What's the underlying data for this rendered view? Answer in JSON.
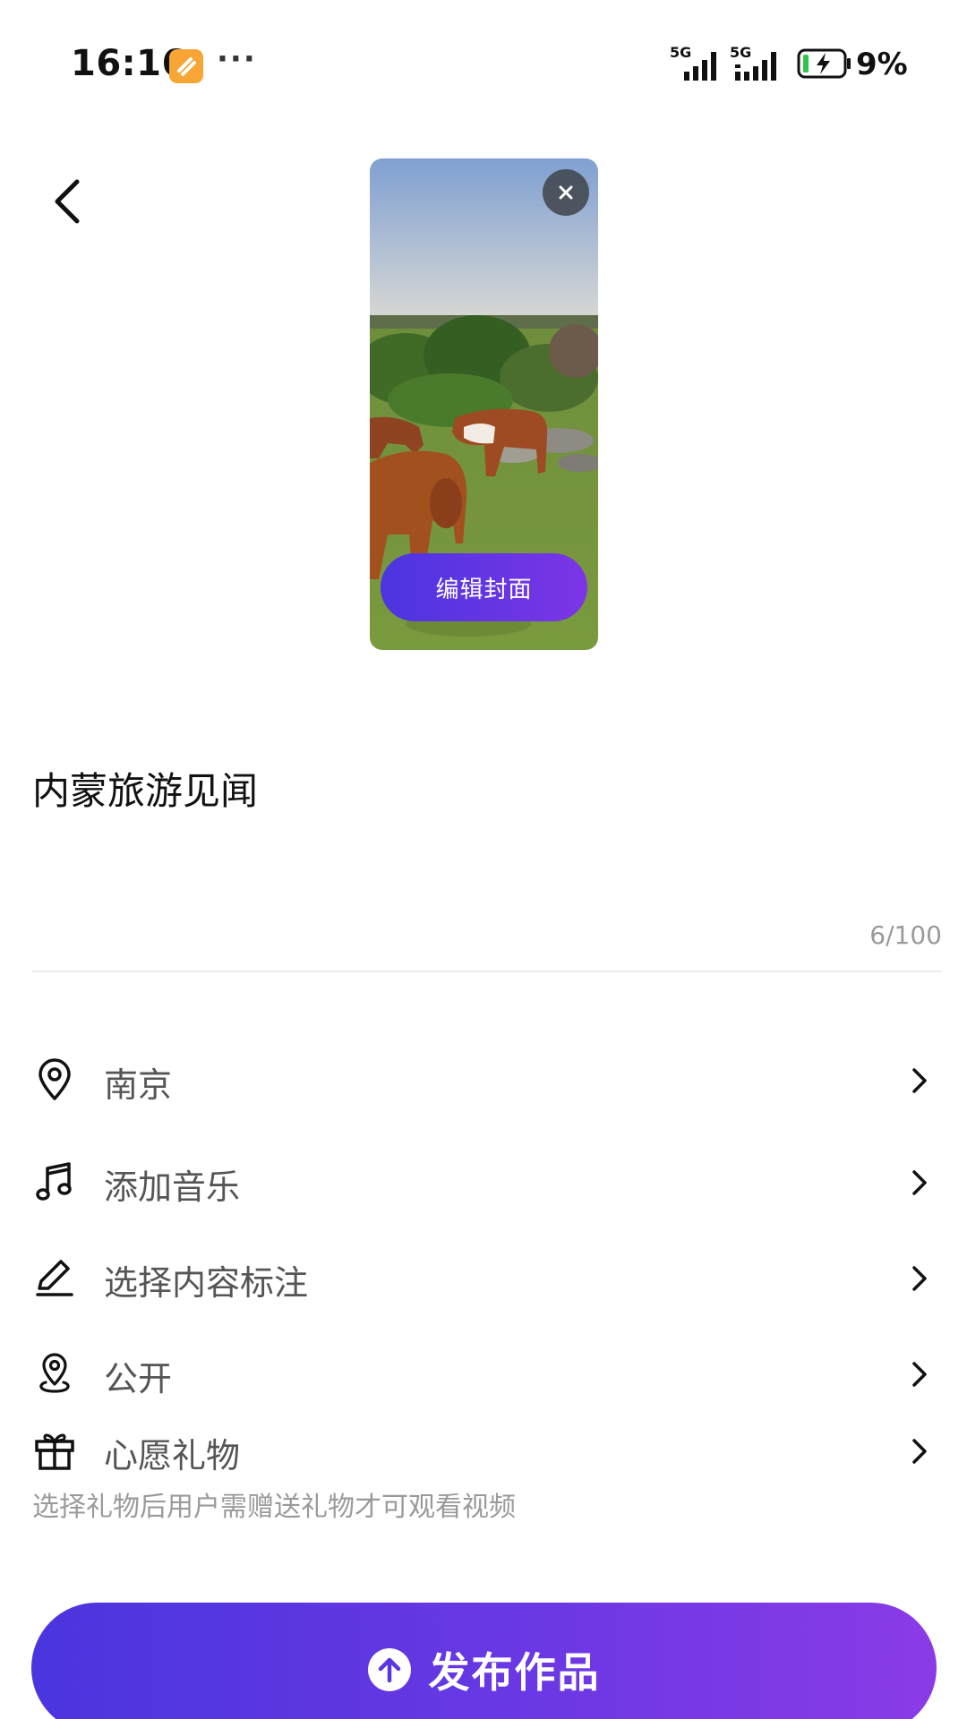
{
  "status_bar": {
    "time": "16:16",
    "overflow": "···",
    "network_1": "5G",
    "network_2": "5G",
    "battery": "9%",
    "icons": [
      "app-notification-icon",
      "signal-icon",
      "battery-charging-icon"
    ]
  },
  "header": {
    "back_icon": "chevron-left-icon"
  },
  "cover": {
    "close_icon": "close-icon",
    "edit_label": "编辑封面",
    "image_description_icon": "cover-thumbnail"
  },
  "post": {
    "title": "内蒙旅游见闻",
    "counter": "6/100"
  },
  "options": [
    {
      "icon": "location-pin-icon",
      "label": "南京"
    },
    {
      "icon": "music-note-icon",
      "label": "添加音乐"
    },
    {
      "icon": "pencil-icon",
      "label": "选择内容标注"
    },
    {
      "icon": "visibility-location-icon",
      "label": "公开"
    },
    {
      "icon": "gift-icon",
      "label": "心愿礼物"
    }
  ],
  "gift_hint": "选择礼物后用户需赠送礼物才可观看视频",
  "publish": {
    "label": "发布作品",
    "icon": "arrow-up-circle-icon"
  },
  "colors": {
    "accent_start": "#4a35de",
    "accent_end": "#8a3be6",
    "text_primary": "#111111",
    "text_secondary": "#555555",
    "text_muted": "#9a9a9a"
  }
}
